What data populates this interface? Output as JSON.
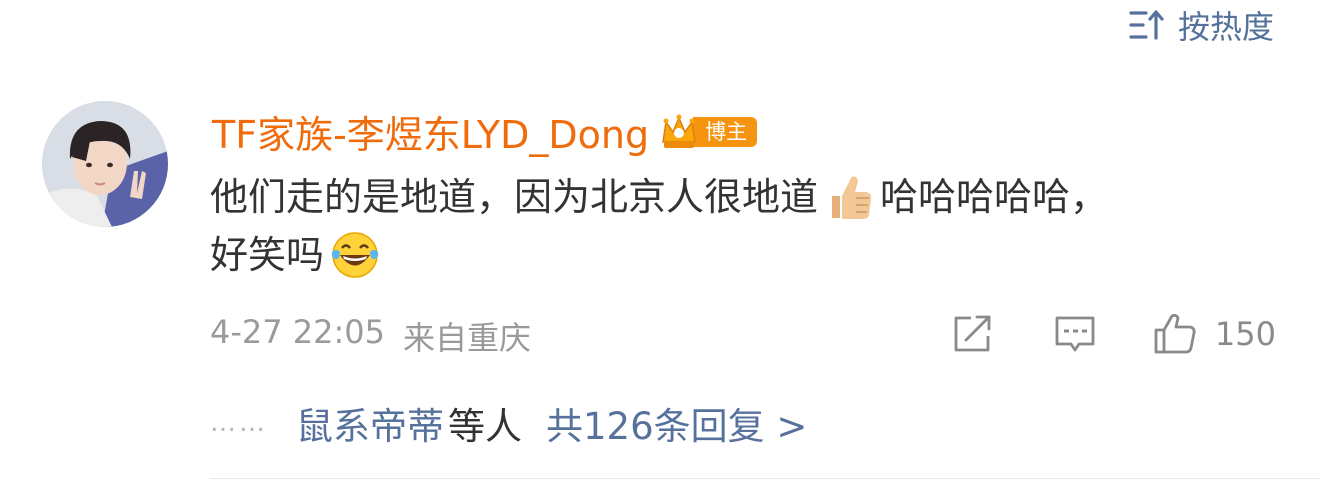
{
  "sort": {
    "label": "按热度",
    "icon": "sort-icon"
  },
  "comment": {
    "username": "TF家族-李煜东LYD_Dong",
    "badge_label": "博主",
    "text_line1_part1": "他们走的是地道，因为北京人很地道",
    "text_line1_part2": "哈哈哈哈哈，",
    "text_line2": "好笑吗",
    "emojis": [
      "thumbs-up-emoji",
      "tears-of-joy-emoji"
    ],
    "date": "4-27 22:05",
    "location": "来自重庆",
    "like_count": "150"
  },
  "replies": {
    "dots": "……",
    "names": "鼠系帝蒂",
    "suffix": "等人",
    "total": "共126条回复 >"
  },
  "colors": {
    "link": "#56729c",
    "username": "#f06b0c",
    "badge": "#f7940f",
    "text": "#333333",
    "muted": "#9a9a9a"
  }
}
